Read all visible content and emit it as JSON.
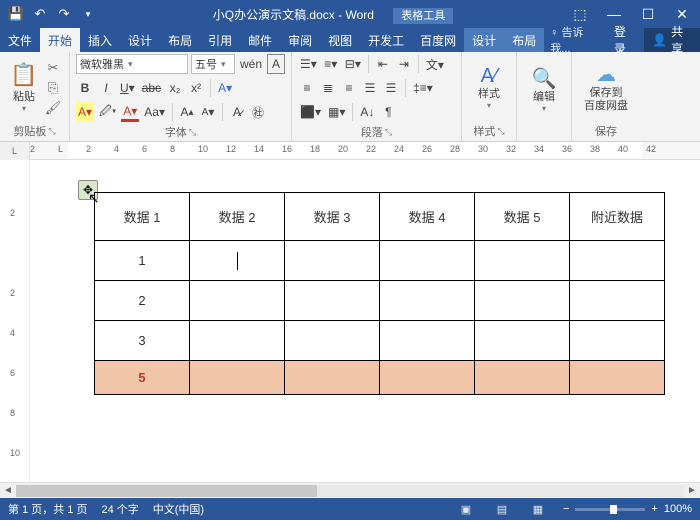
{
  "title": {
    "doc": "小Q办公演示文稿.docx",
    "app": "Word",
    "tabletools": "表格工具"
  },
  "qat": {
    "save": "💾",
    "undo": "↶",
    "redo": "↷",
    "custom": "▾"
  },
  "win": {
    "opts": "⬚",
    "min": "—",
    "max": "☐",
    "close": "✕"
  },
  "tabs": {
    "file": "文件",
    "home": "开始",
    "insert": "插入",
    "design": "设计",
    "layout": "布局",
    "ref": "引用",
    "mail": "邮件",
    "review": "审阅",
    "view": "视图",
    "dev": "开发工",
    "baidu": "百度网",
    "tdesign": "设计",
    "tlayout": "布局"
  },
  "right": {
    "tell": "♀ 告诉我...",
    "login": "登录",
    "share": "共享"
  },
  "ribbon": {
    "clipboard": {
      "paste": "粘贴",
      "label": "剪贴板"
    },
    "font": {
      "name": "微软雅黑",
      "size": "五号",
      "label": "字体"
    },
    "paragraph": {
      "label": "段落"
    },
    "styles": {
      "btn": "样式",
      "label": "样式"
    },
    "editing": {
      "btn": "编辑"
    },
    "save": {
      "btn": "保存到\n百度网盘",
      "label": "保存"
    }
  },
  "ruler_h": [
    "2",
    "L",
    "2",
    "4",
    "6",
    "8",
    "10",
    "12",
    "14",
    "16",
    "18",
    "20",
    "22",
    "24",
    "26",
    "28",
    "30",
    "32",
    "34",
    "36",
    "38",
    "40",
    "42"
  ],
  "ruler_v": [
    "",
    "2",
    "",
    "2",
    "4",
    "6",
    "8",
    "10"
  ],
  "table": {
    "headers": [
      "数据 1",
      "数据 2",
      "数据 3",
      "数据 4",
      "数据 5",
      "附近数据"
    ],
    "rows": [
      [
        "1",
        "",
        "",
        "",
        "",
        ""
      ],
      [
        "2",
        "",
        "",
        "",
        "",
        ""
      ],
      [
        "3",
        "",
        "",
        "",
        "",
        ""
      ]
    ],
    "last": [
      "5",
      "",
      "",
      "",
      "",
      ""
    ]
  },
  "status": {
    "page": "第 1 页，共 1 页",
    "words": "24 个字",
    "lang": "中文(中国)",
    "zoom": "100%"
  }
}
